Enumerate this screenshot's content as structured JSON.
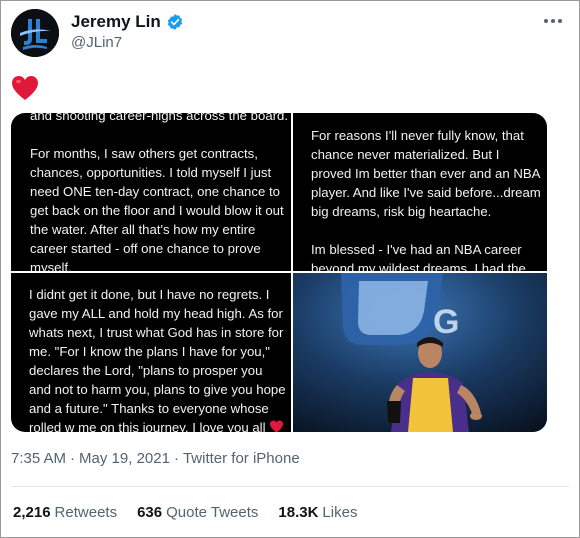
{
  "author": {
    "name": "Jeremy Lin",
    "handle": "@JLin7",
    "verified_icon": "verified-badge-icon",
    "verified_color": "#1d9bf0"
  },
  "tweet": {
    "text_icon": "red-heart-emoji",
    "heart_color": "#e0193a",
    "media": {
      "panel_1": "and shooting career-highs across the board.\n\nFor months, I saw others get contracts, chances, opportunities. I told myself I just need ONE ten-day contract, one chance to get back on the floor and I would blow it out the water. After all that's how my entire career started - off one chance to prove myself.",
      "panel_2": "For reasons I'll never fully know, that chance never materialized. But I proved Im better than ever and an NBA player. And like I've said before...dream big dreams, risk big heartache.\n\nIm blessed - I've had an NBA career beyond my wildest dreams. I had the luxury of taking",
      "panel_3": "I didnt get it done, but I have no regrets. I gave my ALL and hold my head high. As for whats next, I trust what God has in store for me. \"For I know the plans I have for you,\" declares the Lord, \"plans to prosper you and not to harm you, plans to give you hope and a future.\" Thanks to everyone whose rolled w me on this journey. I love you all",
      "panel_4_icon": "basketball-player-photo"
    }
  },
  "meta": {
    "time": "7:35 AM",
    "separator": "·",
    "date": "May 19, 2021",
    "source": "Twitter for iPhone"
  },
  "stats": {
    "retweets_count": "2,216",
    "retweets_label": "Retweets",
    "quotes_count": "636",
    "quotes_label": "Quote Tweets",
    "likes_count": "18.3K",
    "likes_label": "Likes"
  }
}
